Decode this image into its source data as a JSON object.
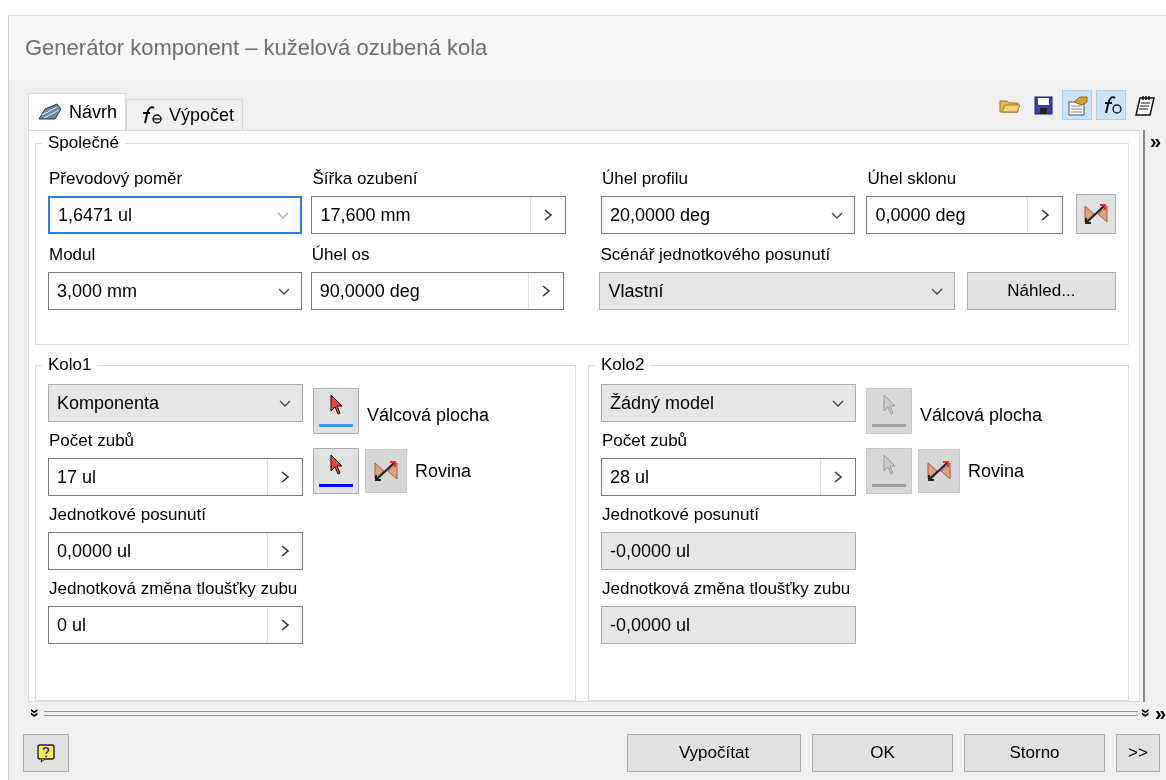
{
  "window": {
    "title": "Generátor komponent – kuželová ozubená kola"
  },
  "tabs": [
    {
      "label": "Návrh",
      "selected": true
    },
    {
      "label": "Výpočet",
      "selected": false
    }
  ],
  "toolbar": [
    {
      "pressed": false
    },
    {
      "pressed": false
    },
    {
      "pressed": true
    },
    {
      "pressed": true
    },
    {
      "pressed": false
    }
  ],
  "common": {
    "title": "Společné",
    "row_1": [
      {
        "label": "Převodový poměr",
        "value": "1,6471 ul",
        "kind": "dropdown",
        "focused": true
      },
      {
        "label": "Šířka ozubení",
        "value": "17,600 mm",
        "kind": "spinner",
        "focused": false
      },
      {
        "label": "Úhel profilu",
        "value": "20,0000 deg",
        "kind": "dropdown",
        "focused": false
      },
      {
        "label": "Úhel sklonu",
        "value": "0,0000 deg",
        "kind": "spinner",
        "focused": false
      }
    ],
    "row_2": [
      {
        "label": "Modul",
        "value": "3,000 mm",
        "kind": "dropdown",
        "focused": false
      },
      {
        "label": "Úhel os",
        "value": "90,0000 deg",
        "kind": "spinner",
        "focused": false
      },
      {
        "label": "Scénář jednotkového posunutí",
        "value": "Vlastní",
        "kind": "list",
        "focused": false
      }
    ],
    "preview_button": "Náhled..."
  },
  "gears": [
    {
      "title": "Kolo1",
      "model": "Komponenta",
      "picks": [
        {
          "label": "Válcová plocha",
          "disabled": false,
          "color": "#3399ff"
        },
        {
          "label": "Rovina",
          "disabled": false,
          "color": "#0000ff"
        }
      ],
      "fields": [
        {
          "label": "Počet zubů",
          "value": "17 ul",
          "kind": "spinner"
        },
        {
          "label": "Jednotkové posunutí",
          "value": "0,0000 ul",
          "kind": "spinner"
        },
        {
          "label": "Jednotková změna tloušťky zubu",
          "value": "0 ul",
          "kind": "spinner"
        }
      ]
    },
    {
      "title": "Kolo2",
      "model": "Žádný model",
      "picks": [
        {
          "label": "Válcová plocha",
          "disabled": true,
          "color": "#a0a0a0"
        },
        {
          "label": "Rovina",
          "disabled": true,
          "color": "#a0a0a0"
        }
      ],
      "fields": [
        {
          "label": "Počet zubů",
          "value": "28 ul",
          "kind": "spinner"
        },
        {
          "label": "Jednotkové posunutí",
          "value": "-0,0000 ul",
          "kind": "static"
        },
        {
          "label": "Jednotková změna tloušťky zubu",
          "value": "-0,0000 ul",
          "kind": "static"
        }
      ]
    }
  ],
  "expanders": {
    "side": "»",
    "bottom_left": "»",
    "bottom_right": "»",
    "corner": "»"
  },
  "buttons": [
    {
      "label": "Vypočítat",
      "kind": "wide"
    },
    {
      "label": "OK",
      "kind": "normal"
    },
    {
      "label": "Storno",
      "kind": "normal"
    },
    {
      "label": ">>",
      "kind": "small"
    }
  ]
}
